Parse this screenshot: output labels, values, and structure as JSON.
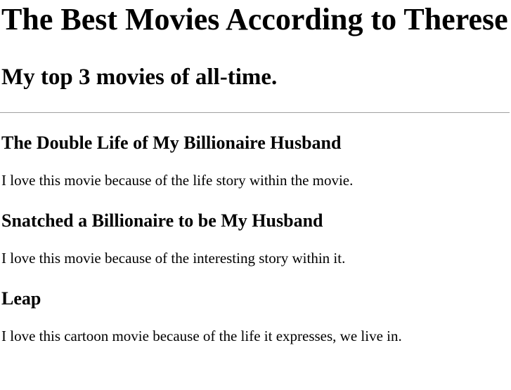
{
  "header": {
    "title": "The Best Movies According to Therese",
    "subtitle": "My top 3 movies of all-time."
  },
  "movies": [
    {
      "title": "The Double Life of My Billionaire Husband",
      "description": "I love this movie because of the life story within the movie."
    },
    {
      "title": "Snatched a Billionaire to be My Husband",
      "description": "I love this movie because of the interesting story within it."
    },
    {
      "title": "Leap",
      "description": "I love this cartoon movie because of the life it expresses, we live in."
    }
  ]
}
